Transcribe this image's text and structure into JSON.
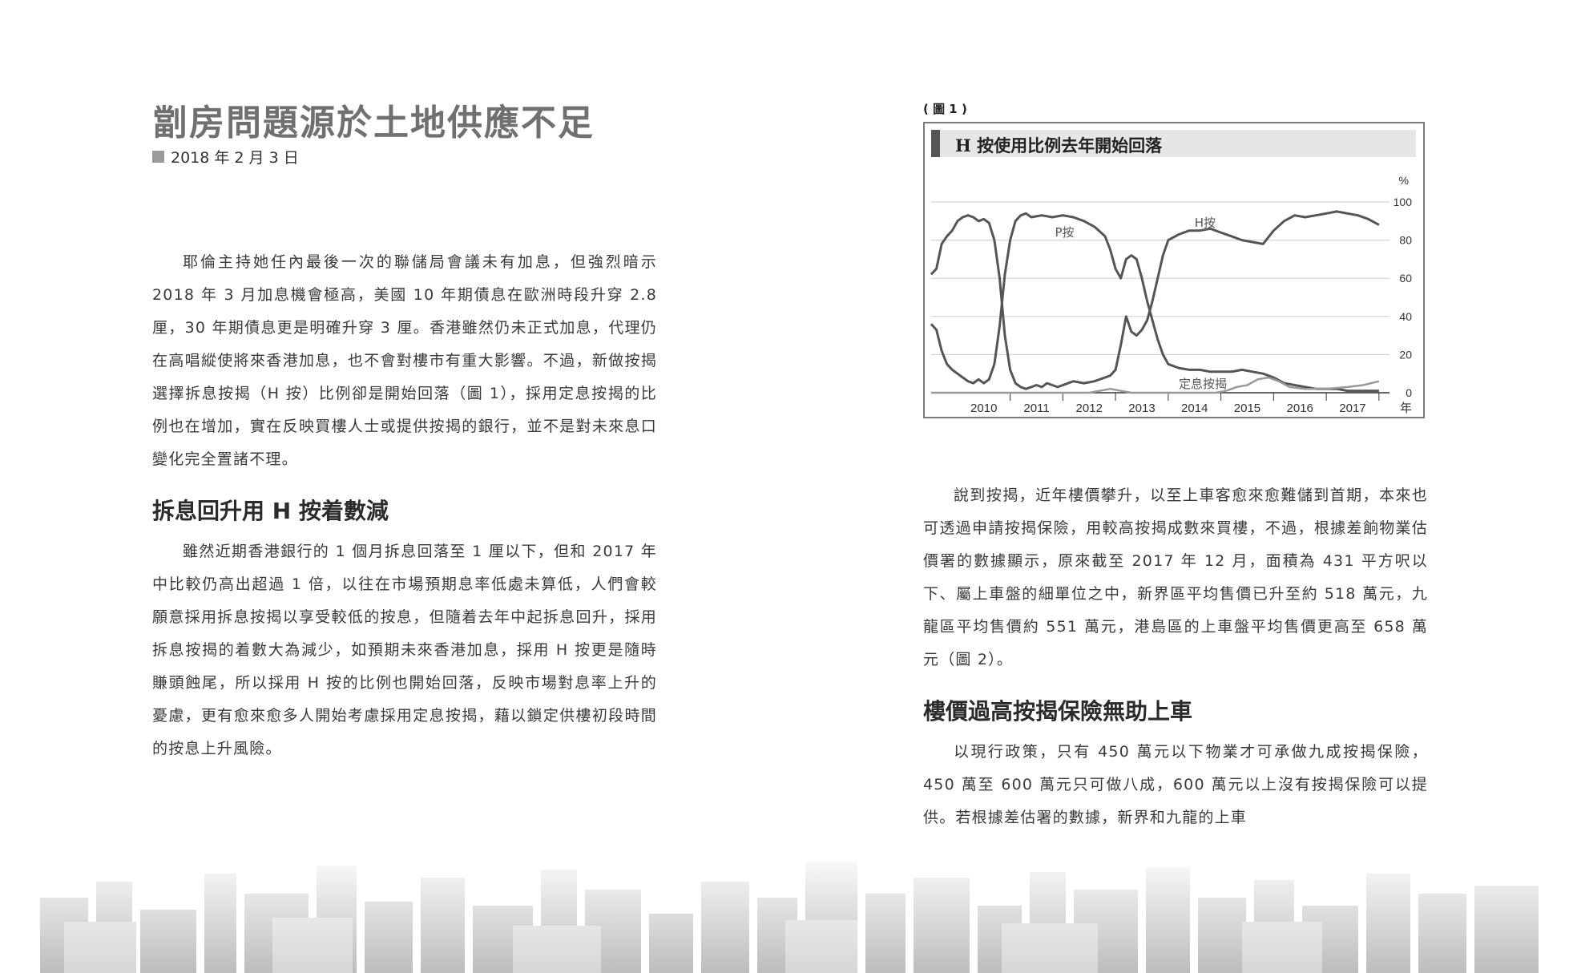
{
  "left": {
    "title": "劏房問題源於土地供應不足",
    "date": "2018 年 2 月 3 日",
    "paragraph1": "耶倫主持她任內最後一次的聯儲局會議未有加息，但強烈暗示 2018 年 3 月加息機會極高，美國 10 年期債息在歐洲時段升穿 2.8 厘，30 年期債息更是明確升穿 3 厘。香港雖然仍未正式加息，代理仍在高唱縱使將來香港加息，也不會對樓市有重大影響。不過，新做按揭選擇拆息按揭（H 按）比例卻是開始回落（圖 1），採用定息按揭的比例也在增加，實在反映買樓人士或提供按揭的銀行，並不是對未來息口變化完全置諸不理。",
    "heading1": "拆息回升用 H 按着數減",
    "paragraph2": "雖然近期香港銀行的 1 個月拆息回落至 1 厘以下，但和 2017 年中比較仍高出超過 1 倍，以往在市場預期息率低處未算低，人們會較願意採用拆息按揭以享受較低的按息，但隨着去年中起拆息回升，採用拆息按揭的着數大為減少，如預期未來香港加息，採用 H 按更是隨時賺頭蝕尾，所以採用 H 按的比例也開始回落，反映市場對息率上升的憂慮，更有愈來愈多人開始考慮採用定息按揭，藉以鎖定供樓初段時間的按息上升風險。"
  },
  "right": {
    "figure_label": "( 圖 1 )",
    "paragraph1": "說到按揭，近年樓價攀升，以至上車客愈來愈難儲到首期，本來也可透過申請按揭保險，用較高按揭成數來買樓，不過，根據差餉物業估價署的數據顯示，原來截至 2017 年 12 月，面積為 431 平方呎以下、屬上車盤的細單位之中，新界區平均售價已升至約 518 萬元，九龍區平均售價約 551 萬元，港島區的上車盤平均售價更高至 658 萬元（圖 2）。",
    "heading1": "樓價過高按揭保險無助上車",
    "paragraph2": "以現行政策，只有 450 萬元以下物業才可承做九成按揭保險，450 萬至 600 萬元只可做八成，600 萬元以上沒有按揭保險可以提供。若根據差估署的數據，新界和九龍的上車"
  },
  "chart_data": {
    "type": "line",
    "title": "H 按使用比例去年開始回落",
    "ylabel": "%",
    "xlabel": "年",
    "ylim": [
      0,
      100
    ],
    "yticks": [
      0,
      20,
      40,
      60,
      80,
      100
    ],
    "xlim": [
      2009.5,
      2018.2
    ],
    "xticks": [
      "2010",
      "2011",
      "2012",
      "2013",
      "2014",
      "2015",
      "2016",
      "2017"
    ],
    "grid": true,
    "colors": {
      "h": "#555555",
      "p": "#555555",
      "fixed": "#999999",
      "grid": "#cccccc"
    },
    "series": [
      {
        "name": "H按",
        "x": [
          2009.5,
          2009.6,
          2009.7,
          2009.8,
          2009.9,
          2010.0,
          2010.1,
          2010.2,
          2010.3,
          2010.4,
          2010.5,
          2010.6,
          2010.7,
          2010.8,
          2010.9,
          2011.0,
          2011.1,
          2011.2,
          2011.3,
          2011.4,
          2011.5,
          2011.6,
          2011.7,
          2011.8,
          2011.9,
          2012.0,
          2012.2,
          2012.4,
          2012.6,
          2012.8,
          2012.9,
          2013.0,
          2013.1,
          2013.2,
          2013.3,
          2013.4,
          2013.5,
          2013.6,
          2013.7,
          2013.8,
          2013.9,
          2014.0,
          2014.2,
          2014.4,
          2014.6,
          2014.8,
          2015.0,
          2015.2,
          2015.4,
          2015.6,
          2015.8,
          2016.0,
          2016.2,
          2016.4,
          2016.6,
          2016.8,
          2017.0,
          2017.2,
          2017.4,
          2017.6,
          2017.8,
          2018.0
        ],
        "y": [
          62,
          65,
          78,
          82,
          85,
          90,
          92,
          93,
          92,
          90,
          91,
          89,
          80,
          60,
          30,
          12,
          5,
          3,
          2,
          3,
          4,
          3,
          5,
          4,
          3,
          4,
          6,
          5,
          6,
          8,
          9,
          12,
          25,
          40,
          32,
          30,
          33,
          38,
          48,
          60,
          72,
          80,
          83,
          85,
          85,
          86,
          84,
          82,
          80,
          79,
          78,
          85,
          90,
          93,
          92,
          93,
          94,
          95,
          94,
          93,
          91,
          88
        ]
      },
      {
        "name": "P按",
        "x": [
          2009.5,
          2009.6,
          2009.7,
          2009.8,
          2009.9,
          2010.0,
          2010.1,
          2010.2,
          2010.3,
          2010.4,
          2010.5,
          2010.6,
          2010.7,
          2010.8,
          2010.9,
          2011.0,
          2011.1,
          2011.2,
          2011.3,
          2011.4,
          2011.6,
          2011.8,
          2012.0,
          2012.2,
          2012.4,
          2012.6,
          2012.8,
          2012.9,
          2013.0,
          2013.1,
          2013.2,
          2013.3,
          2013.4,
          2013.5,
          2013.6,
          2013.7,
          2013.8,
          2013.9,
          2014.0,
          2014.2,
          2014.4,
          2014.6,
          2014.8,
          2015.0,
          2015.2,
          2015.4,
          2015.6,
          2015.8,
          2016.0,
          2016.2,
          2016.4,
          2016.6,
          2016.8,
          2017.0,
          2017.2,
          2017.4,
          2017.6,
          2017.8,
          2018.0
        ],
        "y": [
          36,
          33,
          22,
          15,
          12,
          10,
          8,
          6,
          5,
          7,
          5,
          7,
          15,
          35,
          62,
          80,
          90,
          93,
          94,
          92,
          93,
          92,
          93,
          92,
          90,
          87,
          82,
          75,
          65,
          60,
          70,
          72,
          70,
          60,
          48,
          38,
          28,
          20,
          15,
          13,
          12,
          12,
          11,
          11,
          11,
          12,
          11,
          10,
          8,
          5,
          4,
          3,
          2,
          2,
          2,
          1,
          1,
          1,
          1
        ]
      },
      {
        "name": "定息按揭",
        "x": [
          2009.5,
          2011.5,
          2012.0,
          2012.5,
          2012.7,
          2012.9,
          2013.1,
          2013.3,
          2013.6,
          2014.0,
          2014.5,
          2014.9,
          2015.1,
          2015.3,
          2015.5,
          2015.7,
          2015.9,
          2016.1,
          2016.3,
          2016.6,
          2017.0,
          2017.4,
          2017.7,
          2018.0
        ],
        "y": [
          0,
          0,
          0,
          0,
          1,
          2,
          1,
          0,
          0,
          0,
          0,
          0,
          1,
          3,
          4,
          7,
          8,
          6,
          3,
          2,
          2,
          3,
          4,
          6
        ]
      }
    ],
    "annotations": [
      "P按",
      "H按",
      "定息按揭"
    ]
  }
}
